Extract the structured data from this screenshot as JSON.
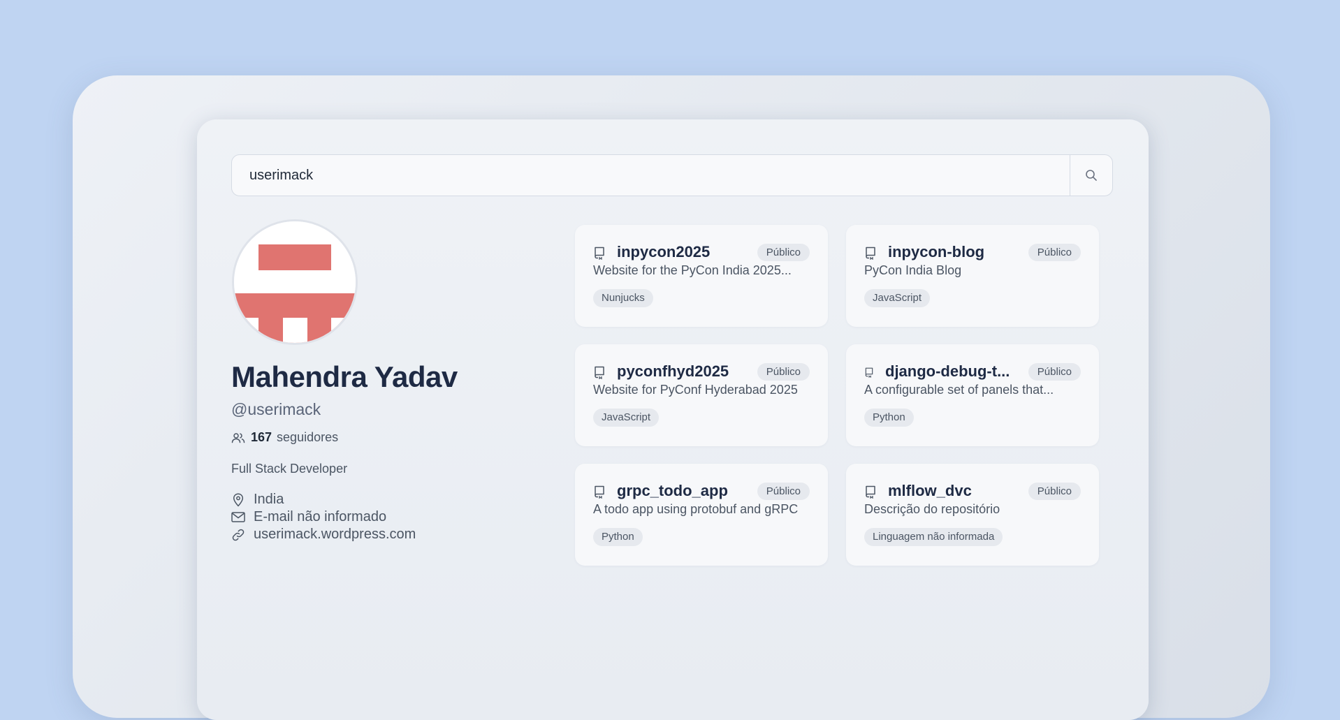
{
  "search": {
    "value": "userimack",
    "button_icon": "search-icon"
  },
  "profile": {
    "name": "Mahendra Yadav",
    "handle": "@userimack",
    "followers_count": "167",
    "followers_label": "seguidores",
    "bio": "Full Stack Developer",
    "location": "India",
    "email": "E-mail não informado",
    "website": "userimack.wordpress.com",
    "avatar_colors": {
      "primary": "#e07470",
      "background": "#ffffff"
    }
  },
  "repos": [
    {
      "name": "inpycon2025",
      "visibility": "Público",
      "description": "Website for the PyCon India 2025...",
      "language": "Nunjucks"
    },
    {
      "name": "inpycon-blog",
      "visibility": "Público",
      "description": "PyCon India Blog",
      "language": "JavaScript"
    },
    {
      "name": "pyconfhyd2025",
      "visibility": "Público",
      "description": "Website for PyConf Hyderabad 2025",
      "language": "JavaScript"
    },
    {
      "name": "django-debug-t...",
      "visibility": "Público",
      "description": "A configurable set of panels that...",
      "language": "Python"
    },
    {
      "name": "grpc_todo_app",
      "visibility": "Público",
      "description": "A todo app using protobuf and gRPC",
      "language": "Python"
    },
    {
      "name": "mlflow_dvc",
      "visibility": "Público",
      "description": "Descrição do repositório",
      "language": "Linguagem não informada"
    }
  ]
}
